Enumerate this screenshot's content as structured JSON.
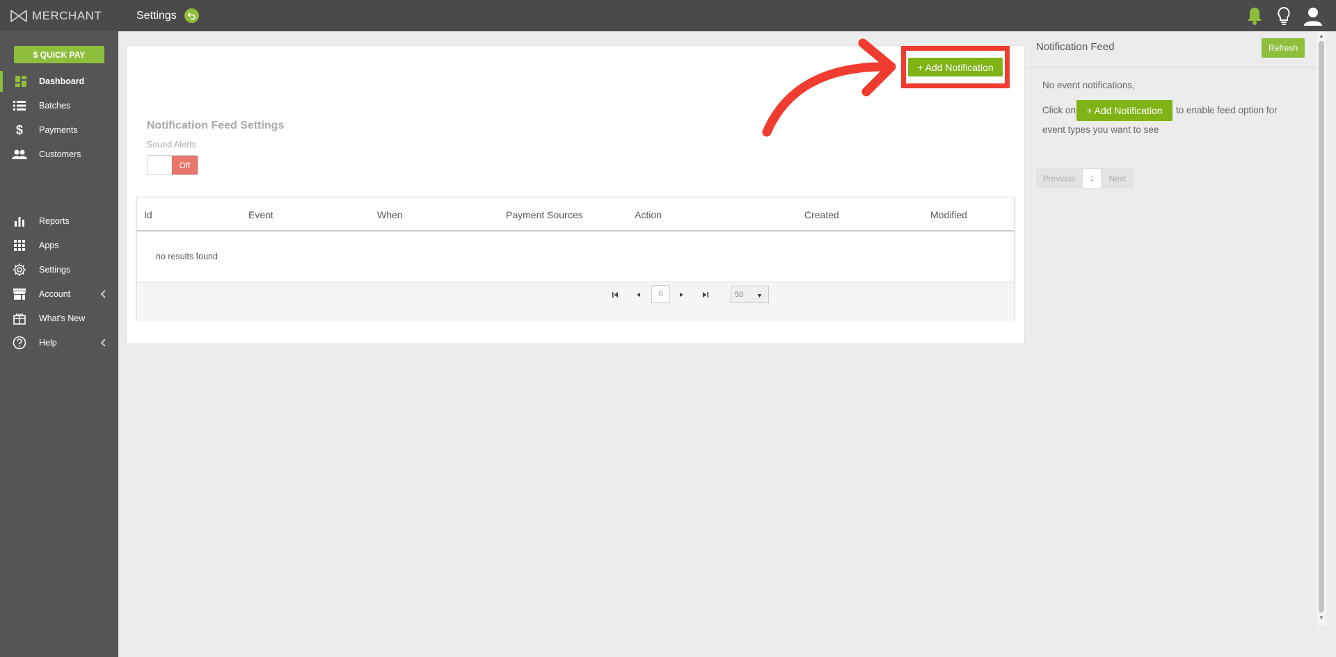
{
  "app": {
    "brand": "MERCHANT",
    "page_title": "Settings"
  },
  "colors": {
    "accent": "#8dbf3c",
    "button_green": "#7fb316",
    "highlight": "#f03b30",
    "toggle_off": "#e8766a"
  },
  "sidebar": {
    "quickpay_label": "$ QUICK PAY",
    "items": [
      {
        "label": "Dashboard",
        "icon": "dashboard-icon",
        "active": true
      },
      {
        "label": "Batches",
        "icon": "batches-icon"
      },
      {
        "label": "Payments",
        "icon": "dollar-icon"
      },
      {
        "label": "Customers",
        "icon": "customers-icon"
      },
      {
        "label": "Reports",
        "icon": "bar-chart-icon"
      },
      {
        "label": "Apps",
        "icon": "apps-grid-icon"
      },
      {
        "label": "Settings",
        "icon": "gear-icon"
      },
      {
        "label": "Account",
        "icon": "store-icon",
        "expandable": true
      },
      {
        "label": "What's New",
        "icon": "gift-icon"
      },
      {
        "label": "Help",
        "icon": "help-icon",
        "expandable": true
      }
    ]
  },
  "main": {
    "add_notification_label": "+ Add Notification",
    "settings_title": "Notification Feed Settings",
    "sound_alerts_label": "Sound Alerts",
    "sound_toggle_value": "Off",
    "table": {
      "columns": [
        "Id",
        "Event",
        "When",
        "Payment Sources",
        "Action",
        "Created",
        "Modified"
      ],
      "empty_text": "no results found",
      "pagination": {
        "current_page": "0",
        "page_size": "50"
      }
    }
  },
  "feed": {
    "title": "Notification Feed",
    "refresh_label": "Refresh",
    "empty_text": "No event notifications,",
    "click_prefix": "Click on",
    "add_label": "+ Add Notification",
    "click_suffix_line1": "to enable feed option for",
    "click_suffix_line2": "event types you want to see",
    "pager": {
      "previous": "Previous",
      "page": "1",
      "next": "Next"
    }
  }
}
